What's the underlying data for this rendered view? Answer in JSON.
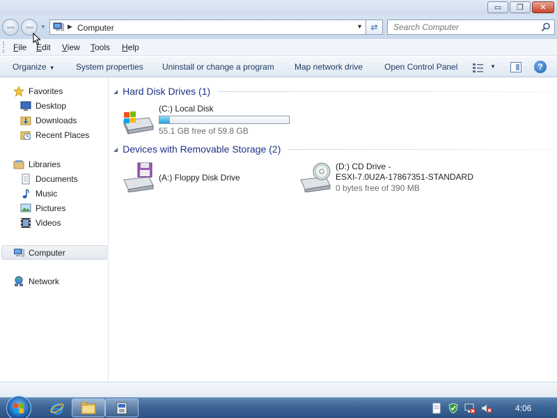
{
  "window": {
    "caption_buttons": {
      "minimize": "▭",
      "maximize": "❐",
      "close": "✕"
    }
  },
  "address": {
    "path": "Computer",
    "search_placeholder": "Search Computer"
  },
  "menu": {
    "items": [
      {
        "mnemonic": "F",
        "rest": "ile"
      },
      {
        "mnemonic": "E",
        "rest": "dit"
      },
      {
        "mnemonic": "V",
        "rest": "iew"
      },
      {
        "mnemonic": "T",
        "rest": "ools"
      },
      {
        "mnemonic": "H",
        "rest": "elp"
      }
    ]
  },
  "commands": {
    "organize": "Organize",
    "system_properties": "System properties",
    "uninstall": "Uninstall or change a program",
    "map_network": "Map network drive",
    "open_control_panel": "Open Control Panel",
    "help": "?"
  },
  "nav": {
    "favorites": "Favorites",
    "desktop": "Desktop",
    "downloads": "Downloads",
    "recent_places": "Recent Places",
    "libraries": "Libraries",
    "documents": "Documents",
    "music": "Music",
    "pictures": "Pictures",
    "videos": "Videos",
    "computer": "Computer",
    "network": "Network"
  },
  "content": {
    "groups": {
      "hard_disks": "Hard Disk Drives (1)",
      "removable": "Devices with Removable Storage (2)"
    },
    "drives": {
      "c": {
        "name": "(C:) Local Disk",
        "free": "55.1 GB free of 59.8 GB",
        "used_fraction": 0.079
      },
      "a": {
        "name": "(A:) Floppy Disk Drive"
      },
      "d": {
        "name": "(D:) CD Drive -",
        "label": "ESXI-7.0U2A-17867351-STANDARD",
        "free": "0 bytes free of 390 MB"
      }
    }
  },
  "taskbar": {
    "clock": "4:06"
  },
  "colors": {
    "group_title": "#1e3287",
    "usage_fill": "#26a0da",
    "taskbar": "#3c6494"
  }
}
